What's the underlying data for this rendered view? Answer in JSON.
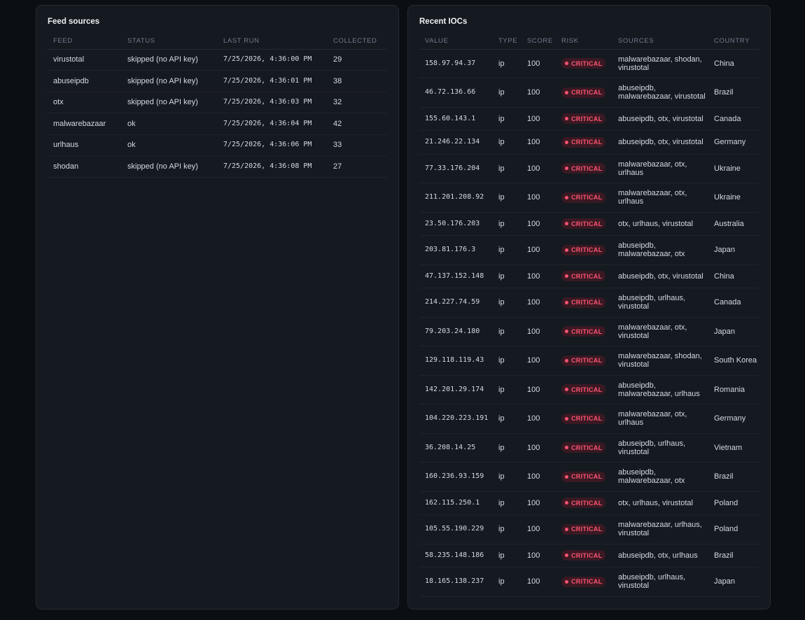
{
  "feeds": {
    "title": "Feed sources",
    "columns": [
      "FEED",
      "STATUS",
      "LAST RUN",
      "COLLECTED"
    ],
    "rows": [
      {
        "feed": "virustotal",
        "status": "skipped (no API key)",
        "last_run": "7/25/2026, 4:36:00 PM",
        "collected": "29"
      },
      {
        "feed": "abuseipdb",
        "status": "skipped (no API key)",
        "last_run": "7/25/2026, 4:36:01 PM",
        "collected": "38"
      },
      {
        "feed": "otx",
        "status": "skipped (no API key)",
        "last_run": "7/25/2026, 4:36:03 PM",
        "collected": "32"
      },
      {
        "feed": "malwarebazaar",
        "status": "ok",
        "last_run": "7/25/2026, 4:36:04 PM",
        "collected": "42"
      },
      {
        "feed": "urlhaus",
        "status": "ok",
        "last_run": "7/25/2026, 4:36:06 PM",
        "collected": "33"
      },
      {
        "feed": "shodan",
        "status": "skipped (no API key)",
        "last_run": "7/25/2026, 4:36:08 PM",
        "collected": "27"
      }
    ]
  },
  "iocs": {
    "title": "Recent IOCs",
    "columns": [
      "VALUE",
      "TYPE",
      "SCORE",
      "RISK",
      "SOURCES",
      "COUNTRY"
    ],
    "risk_color": "#ff5472",
    "rows": [
      {
        "value": "158.97.94.37",
        "type": "ip",
        "score": "100",
        "risk": "CRITICAL",
        "sources": "malwarebazaar, shodan, virustotal",
        "country": "China"
      },
      {
        "value": "46.72.136.66",
        "type": "ip",
        "score": "100",
        "risk": "CRITICAL",
        "sources": "abuseipdb, malwarebazaar, virustotal",
        "country": "Brazil"
      },
      {
        "value": "155.60.143.1",
        "type": "ip",
        "score": "100",
        "risk": "CRITICAL",
        "sources": "abuseipdb, otx, virustotal",
        "country": "Canada"
      },
      {
        "value": "21.246.22.134",
        "type": "ip",
        "score": "100",
        "risk": "CRITICAL",
        "sources": "abuseipdb, otx, virustotal",
        "country": "Germany"
      },
      {
        "value": "77.33.176.204",
        "type": "ip",
        "score": "100",
        "risk": "CRITICAL",
        "sources": "malwarebazaar, otx, urlhaus",
        "country": "Ukraine"
      },
      {
        "value": "211.201.208.92",
        "type": "ip",
        "score": "100",
        "risk": "CRITICAL",
        "sources": "malwarebazaar, otx, urlhaus",
        "country": "Ukraine"
      },
      {
        "value": "23.50.176.203",
        "type": "ip",
        "score": "100",
        "risk": "CRITICAL",
        "sources": "otx, urlhaus, virustotal",
        "country": "Australia"
      },
      {
        "value": "203.81.176.3",
        "type": "ip",
        "score": "100",
        "risk": "CRITICAL",
        "sources": "abuseipdb, malwarebazaar, otx",
        "country": "Japan"
      },
      {
        "value": "47.137.152.148",
        "type": "ip",
        "score": "100",
        "risk": "CRITICAL",
        "sources": "abuseipdb, otx, virustotal",
        "country": "China"
      },
      {
        "value": "214.227.74.59",
        "type": "ip",
        "score": "100",
        "risk": "CRITICAL",
        "sources": "abuseipdb, urlhaus, virustotal",
        "country": "Canada"
      },
      {
        "value": "79.203.24.180",
        "type": "ip",
        "score": "100",
        "risk": "CRITICAL",
        "sources": "malwarebazaar, otx, virustotal",
        "country": "Japan"
      },
      {
        "value": "129.118.119.43",
        "type": "ip",
        "score": "100",
        "risk": "CRITICAL",
        "sources": "malwarebazaar, shodan, virustotal",
        "country": "South Korea"
      },
      {
        "value": "142.201.29.174",
        "type": "ip",
        "score": "100",
        "risk": "CRITICAL",
        "sources": "abuseipdb, malwarebazaar, urlhaus",
        "country": "Romania"
      },
      {
        "value": "104.220.223.191",
        "type": "ip",
        "score": "100",
        "risk": "CRITICAL",
        "sources": "malwarebazaar, otx, urlhaus",
        "country": "Germany"
      },
      {
        "value": "36.208.14.25",
        "type": "ip",
        "score": "100",
        "risk": "CRITICAL",
        "sources": "abuseipdb, urlhaus, virustotal",
        "country": "Vietnam"
      },
      {
        "value": "160.236.93.159",
        "type": "ip",
        "score": "100",
        "risk": "CRITICAL",
        "sources": "abuseipdb, malwarebazaar, otx",
        "country": "Brazil"
      },
      {
        "value": "162.115.250.1",
        "type": "ip",
        "score": "100",
        "risk": "CRITICAL",
        "sources": "otx, urlhaus, virustotal",
        "country": "Poland"
      },
      {
        "value": "105.55.190.229",
        "type": "ip",
        "score": "100",
        "risk": "CRITICAL",
        "sources": "malwarebazaar, urlhaus, virustotal",
        "country": "Poland"
      },
      {
        "value": "58.235.148.186",
        "type": "ip",
        "score": "100",
        "risk": "CRITICAL",
        "sources": "abuseipdb, otx, urlhaus",
        "country": "Brazil"
      },
      {
        "value": "18.165.138.237",
        "type": "ip",
        "score": "100",
        "risk": "CRITICAL",
        "sources": "abuseipdb, urlhaus, virustotal",
        "country": "Japan"
      }
    ]
  }
}
